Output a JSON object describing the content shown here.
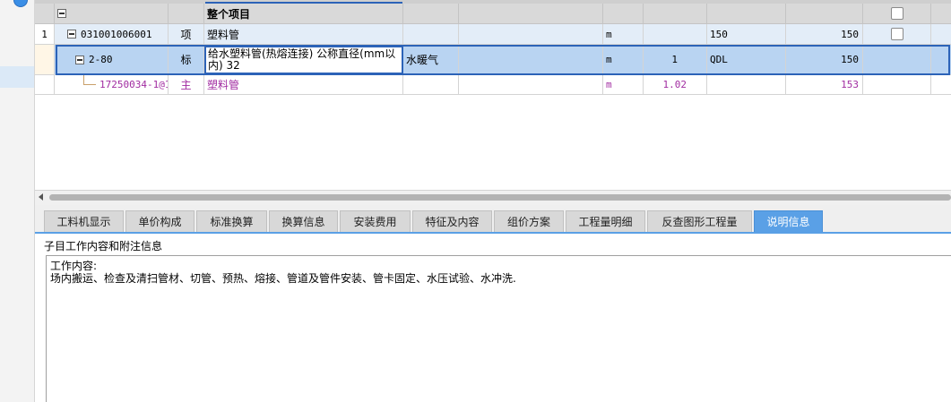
{
  "grid": {
    "project_row": {
      "title": "整个项目"
    },
    "item_row": {
      "index": "1",
      "code": "031001006001",
      "type": "项",
      "name": "塑料管",
      "unit": "m",
      "value1": "150",
      "value2": "150"
    },
    "quota_row": {
      "code": "2-80",
      "type": "标",
      "name": "给水塑料管(热熔连接) 公称直径(mm以内) 32",
      "category": "水暖气",
      "unit": "m",
      "quantity": "1",
      "formula": "QDL",
      "value2": "150"
    },
    "main_row": {
      "code": "17250034-1@1",
      "type": "主",
      "name": "塑料管",
      "unit": "m",
      "quantity": "1.02",
      "value2": "153"
    }
  },
  "tabs": [
    "工料机显示",
    "单价构成",
    "标准换算",
    "换算信息",
    "安装费用",
    "特征及内容",
    "组价方案",
    "工程量明细",
    "反查图形工程量",
    "说明信息"
  ],
  "active_tab": "说明信息",
  "panel": {
    "caption": "子目工作内容和附注信息",
    "content": "工作内容:\n场内搬运、检查及清扫管材、切管、预热、熔接、管道及管件安装、管卡固定、水压试验、水冲洗."
  },
  "colors": {
    "accent": "#5aa0e6",
    "selection_border": "#2c63b8",
    "main_material_text": "#a12ca1"
  }
}
